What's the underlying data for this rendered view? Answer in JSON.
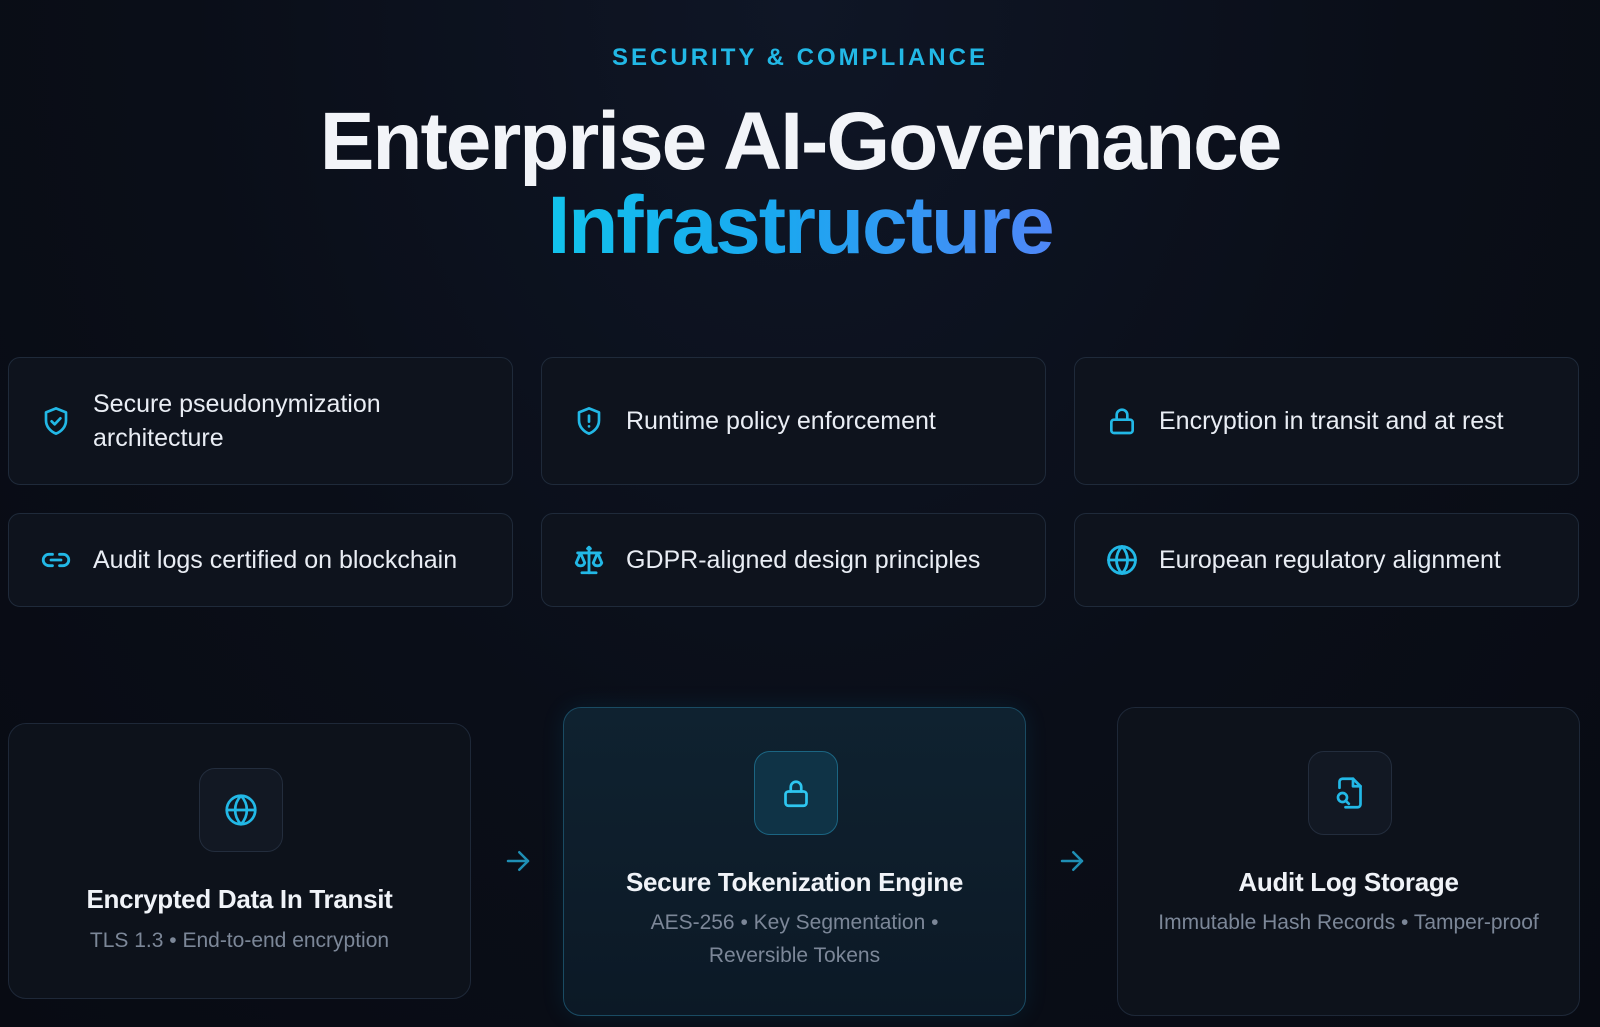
{
  "header": {
    "eyebrow": "SECURITY & COMPLIANCE",
    "title_line1": "Enterprise AI-Governance",
    "title_line2": "Infrastructure"
  },
  "features": [
    {
      "label": "Secure pseudonymization architecture",
      "icon": "shield-check-icon"
    },
    {
      "label": "Runtime policy enforcement",
      "icon": "shield-alert-icon"
    },
    {
      "label": "Encryption in transit and at rest",
      "icon": "lock-icon"
    },
    {
      "label": "Audit logs certified on blockchain",
      "icon": "link-icon"
    },
    {
      "label": "GDPR-aligned design principles",
      "icon": "scale-icon"
    },
    {
      "label": "European regulatory alignment",
      "icon": "globe-icon"
    }
  ],
  "pipeline": [
    {
      "title": "Encrypted Data In Transit",
      "subtitle": "TLS 1.3 • End-to-end encryption",
      "icon": "globe-icon"
    },
    {
      "title": "Secure Tokenization Engine",
      "subtitle": "AES-256 • Key Segmentation • Reversible Tokens",
      "icon": "lock-icon"
    },
    {
      "title": "Audit Log Storage",
      "subtitle": "Immutable Hash Records • Tamper-proof",
      "icon": "file-search-icon"
    }
  ],
  "colors": {
    "background": "#0a0e18",
    "accent": "#22b8e6",
    "gradient_start": "#12c3ec",
    "gradient_end": "#4f86f7",
    "card_border": "#1f2a3a",
    "muted_text": "#7c8798"
  }
}
